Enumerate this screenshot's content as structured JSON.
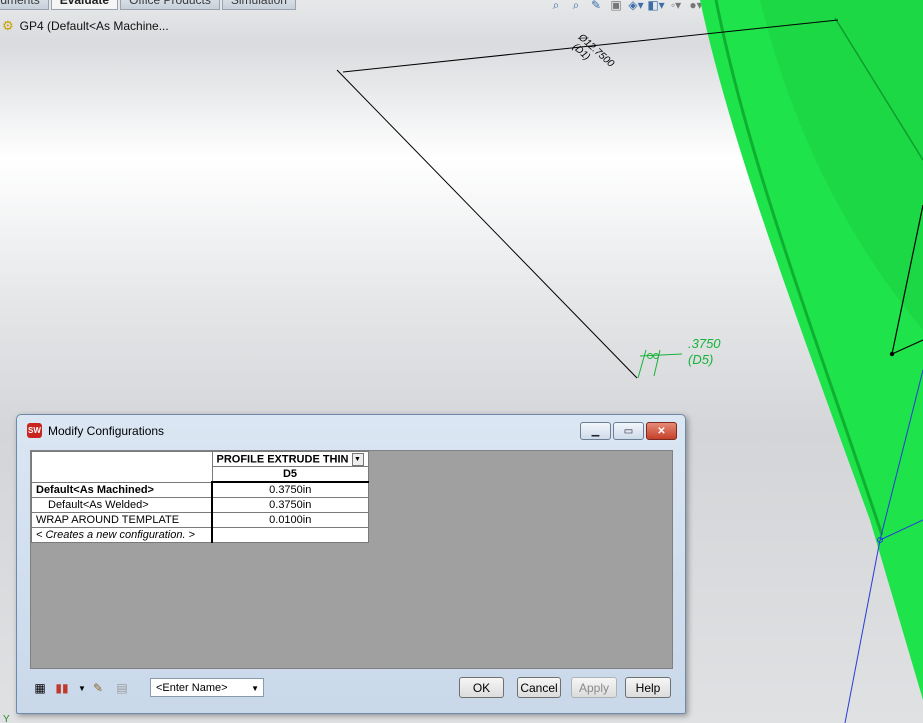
{
  "tabs": [
    "eldments",
    "Evaluate",
    "Office Products",
    "Simulation"
  ],
  "document": {
    "title": "GP4  (Default<As Machine..."
  },
  "toolbar_icons": [
    "zoom-fit-icon",
    "zoom-area-icon",
    "section-view-icon",
    "view-orientation-icon",
    "display-style-icon",
    "hide-show-icon",
    "appearance-icon",
    "scene-icon",
    "render-icon"
  ],
  "annotations": {
    "dim1_line1": "Ø12.7500",
    "dim1_line2": "(D1)",
    "dim2_line1": ".3750",
    "dim2_line2": "(D5)"
  },
  "colors": {
    "body_green": "#1ee34a",
    "dim_green": "#18b23a",
    "sketch_blue": "#2a3bd8"
  },
  "dialog": {
    "title": "Modify Configurations",
    "feature_header": "PROFILE EXTRUDE THIN",
    "dimension_header": "D5",
    "rows": [
      {
        "name": "Default<As Machined>",
        "value": "0.3750in"
      },
      {
        "name": "Default<As Welded>",
        "value": "0.3750in"
      },
      {
        "name": "WRAP AROUND TEMPLATE",
        "value": "0.0100in"
      }
    ],
    "new_config": "< Creates a new configuration. >",
    "name_field": "<Enter Name>",
    "buttons": {
      "ok": "OK",
      "cancel": "Cancel",
      "apply": "Apply",
      "help": "Help"
    }
  }
}
